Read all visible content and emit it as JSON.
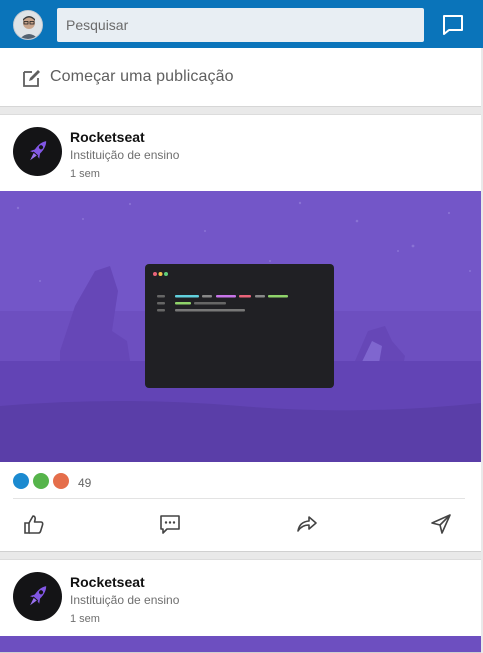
{
  "search": {
    "placeholder": "Pesquisar"
  },
  "compose": {
    "label": "Começar uma publicação"
  },
  "posts": [
    {
      "author": "Rocketseat",
      "subtitle": "Instituição de ensino",
      "time": "1 sem",
      "reactions_count": "49",
      "reaction_colors": [
        "#1b8ad0",
        "#56b44b",
        "#e56e4b"
      ]
    },
    {
      "author": "Rocketseat",
      "subtitle": "Instituição de ensino",
      "time": "1 sem"
    }
  ],
  "colors": {
    "topbar": "#0a74ba",
    "banner": "#6d4fc0",
    "logo_accent": "#8257e5"
  },
  "icons": {
    "messaging": "message-icon",
    "compose": "edit-icon",
    "like": "thumbs-up-icon",
    "comment": "comment-icon",
    "share": "share-icon",
    "send": "send-icon"
  }
}
